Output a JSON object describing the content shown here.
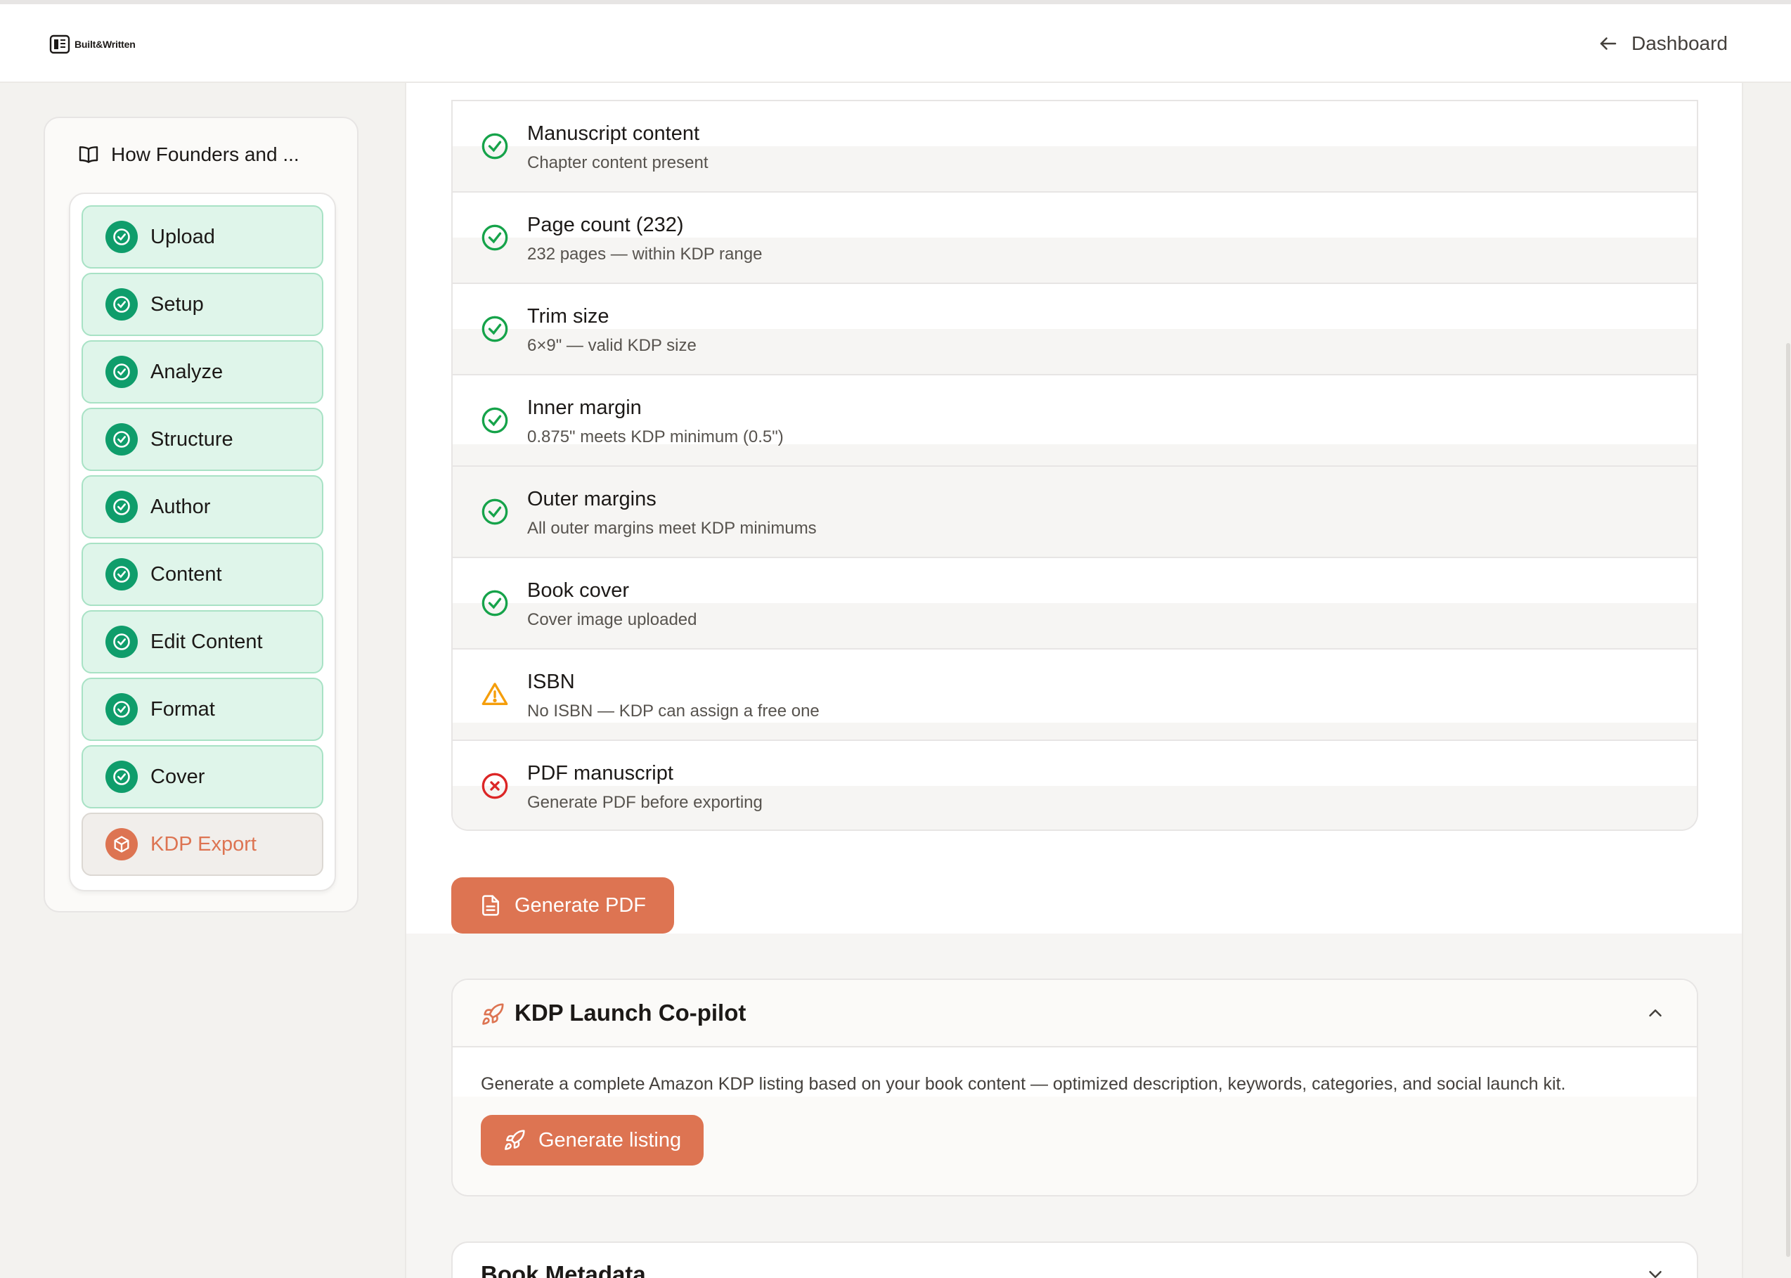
{
  "header": {
    "brand": "Built&Written",
    "dashboard_label": "Dashboard"
  },
  "sidebar": {
    "project_title": "How Founders and ...",
    "steps": [
      {
        "label": "Upload",
        "status": "done"
      },
      {
        "label": "Setup",
        "status": "done"
      },
      {
        "label": "Analyze",
        "status": "done"
      },
      {
        "label": "Structure",
        "status": "done"
      },
      {
        "label": "Author",
        "status": "done"
      },
      {
        "label": "Content",
        "status": "done"
      },
      {
        "label": "Edit Content",
        "status": "done"
      },
      {
        "label": "Format",
        "status": "done"
      },
      {
        "label": "Cover",
        "status": "done"
      },
      {
        "label": "KDP Export",
        "status": "active"
      }
    ]
  },
  "checklist": [
    {
      "title": "Manuscript content",
      "detail": "Chapter content present",
      "status": "pass"
    },
    {
      "title": "Page count (232)",
      "detail": "232 pages — within KDP range",
      "status": "pass"
    },
    {
      "title": "Trim size",
      "detail": "6×9\" — valid KDP size",
      "status": "pass"
    },
    {
      "title": "Inner margin",
      "detail": "0.875\" meets KDP minimum (0.5\")",
      "status": "pass"
    },
    {
      "title": "Outer margins",
      "detail": "All outer margins meet KDP minimums",
      "status": "pass"
    },
    {
      "title": "Book cover",
      "detail": "Cover image uploaded",
      "status": "pass"
    },
    {
      "title": "ISBN",
      "detail": "No ISBN — KDP can assign a free one",
      "status": "warning"
    },
    {
      "title": "PDF manuscript",
      "detail": "Generate PDF before exporting",
      "status": "error"
    }
  ],
  "actions": {
    "generate_pdf": "Generate PDF"
  },
  "copilot": {
    "title": "KDP Launch Co-pilot",
    "description": "Generate a complete Amazon KDP listing based on your book content — optimized description, keywords, categories, and social launch kit.",
    "button": "Generate listing"
  },
  "metadata": {
    "title": "Book Metadata"
  },
  "colors": {
    "accent": "#dd7452",
    "success": "#0f9d6b",
    "success_bg": "#dff5ea",
    "warning": "#f59e0b",
    "error": "#dc2626"
  }
}
